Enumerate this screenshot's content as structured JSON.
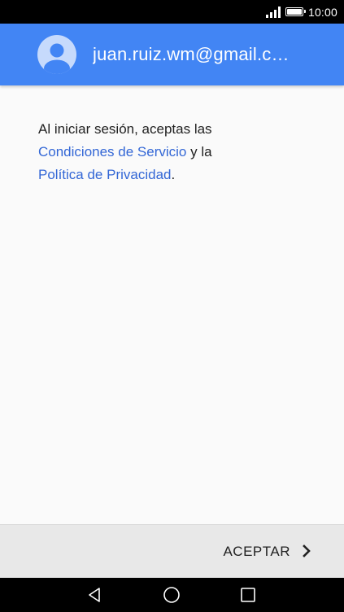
{
  "status_bar": {
    "time": "10:00",
    "icons": [
      "signal-icon",
      "battery-icon"
    ]
  },
  "account": {
    "email": "juan.ruiz.wm@gmail.c…",
    "avatar_icon": "person-avatar-icon"
  },
  "terms": {
    "intro": "Al iniciar sesión, aceptas las",
    "terms_link": "Condiciones de Servicio",
    "conjunction": " y la",
    "privacy_link": "Política de Privacidad",
    "ending": "."
  },
  "footer": {
    "accept_label": "ACEPTAR",
    "accept_icon": "chevron-right-icon"
  },
  "nav_bar": {
    "icons": [
      "back-icon",
      "home-icon",
      "recents-icon"
    ]
  },
  "colors": {
    "header": "#4285f4",
    "link": "#3367d6",
    "footer": "#e8e8e8",
    "background": "#fafafa"
  }
}
